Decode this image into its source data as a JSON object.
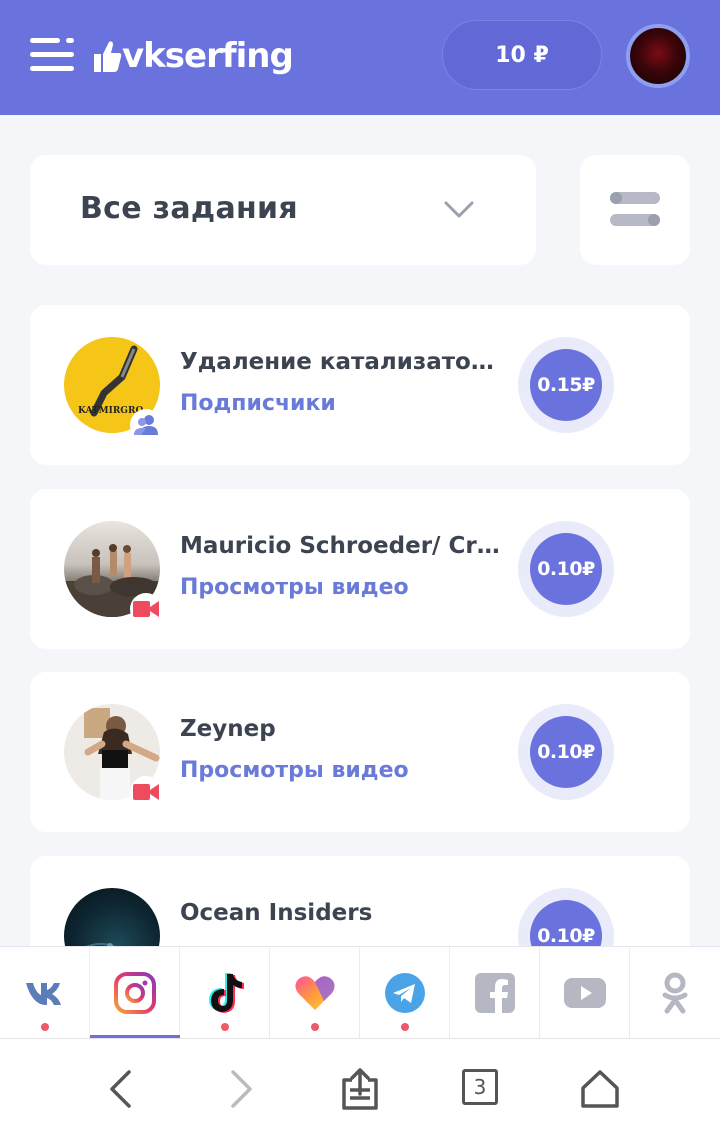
{
  "header": {
    "logo_text": "vkserfing",
    "balance": "10 ₽"
  },
  "filter": {
    "selected": "Все задания"
  },
  "tasks": [
    {
      "title": "Удаление катализаторо..",
      "type": "Подписчики",
      "price": "0.15₽",
      "badge": "users-icon"
    },
    {
      "title": "Mauricio Schroeder/ Cre...",
      "type": "Просмотры видео",
      "price": "0.10₽",
      "badge": "video-camera-icon"
    },
    {
      "title": "Zeynep",
      "type": "Просмотры видео",
      "price": "0.10₽",
      "badge": "video-camera-icon"
    },
    {
      "title": "Ocean Insiders",
      "type": "",
      "price": "0.10₽",
      "badge": ""
    }
  ],
  "social_tabs": [
    {
      "name": "vk-icon",
      "active": false,
      "dot": true
    },
    {
      "name": "instagram-icon",
      "active": true,
      "dot": false
    },
    {
      "name": "tiktok-icon",
      "active": false,
      "dot": true
    },
    {
      "name": "likee-icon",
      "active": false,
      "dot": true
    },
    {
      "name": "telegram-icon",
      "active": false,
      "dot": true
    },
    {
      "name": "facebook-icon",
      "active": false,
      "dot": false
    },
    {
      "name": "youtube-icon",
      "active": false,
      "dot": false
    },
    {
      "name": "odnoklassniki-icon",
      "active": false,
      "dot": false
    }
  ],
  "browser": {
    "tab_count": "3"
  },
  "colors": {
    "accent": "#6a72dd",
    "link": "#6a7ad8",
    "notification_dot": "#ef5a6a"
  }
}
